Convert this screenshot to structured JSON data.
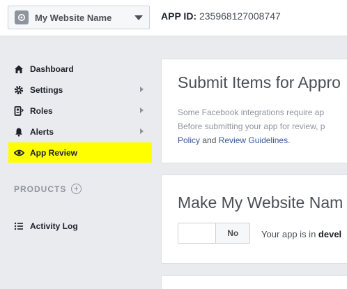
{
  "header": {
    "app_name": "My Website Name",
    "app_id_label": "APP ID:",
    "app_id_value": "235968127008747",
    "app_icon": "app-gear-icon",
    "dropdown_icon": "caret-down-icon"
  },
  "sidebar": {
    "items": [
      {
        "label": "Dashboard",
        "icon": "home-icon",
        "has_submenu": false
      },
      {
        "label": "Settings",
        "icon": "gear-icon",
        "has_submenu": true
      },
      {
        "label": "Roles",
        "icon": "roles-icon",
        "has_submenu": true
      },
      {
        "label": "Alerts",
        "icon": "bell-icon",
        "has_submenu": true
      },
      {
        "label": "App Review",
        "icon": "eye-icon",
        "has_submenu": false,
        "active": true
      }
    ],
    "products_label": "PRODUCTS",
    "products_add_icon": "add-circle-icon",
    "activity_log": {
      "label": "Activity Log",
      "icon": "list-icon"
    }
  },
  "submit_card": {
    "title": "Submit Items for Appro",
    "line1": "Some Facebook integrations require ap",
    "line2": "Before submitting your app for review, p",
    "link1": "Policy",
    "conjunction": " and ",
    "link2": "Review Guidelines",
    "period": "."
  },
  "public_card": {
    "title": "Make My Website Nam",
    "toggle_state": "No",
    "status_prefix": "Your app is in ",
    "status_bold": "devel"
  },
  "colors": {
    "active_highlight": "#ffff00",
    "link": "#365899",
    "page_background": "#e9ebee"
  }
}
